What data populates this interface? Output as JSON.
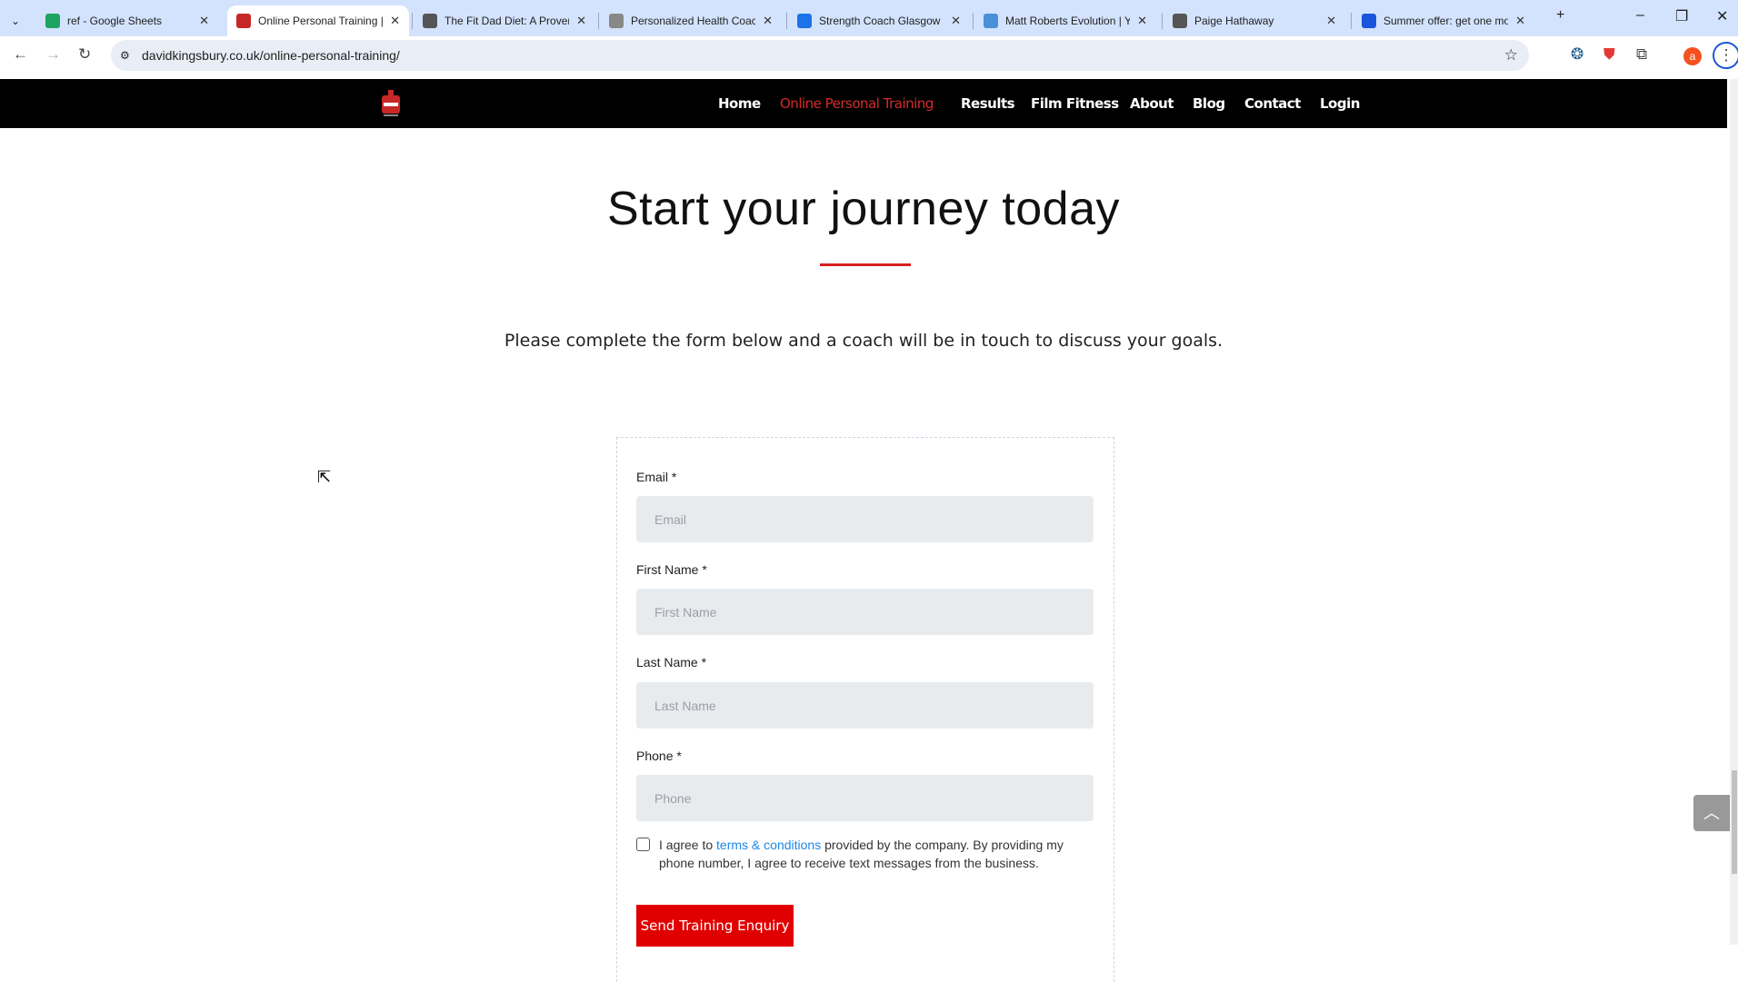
{
  "browser": {
    "tabs": [
      {
        "title": "ref - Google Sheets",
        "icon": "sheets-icon",
        "color": "#1ea362"
      },
      {
        "title": "Online Personal Training |",
        "icon": "kingsbury-icon",
        "color": "#c62828",
        "active": true
      },
      {
        "title": "The Fit Dad Diet: A Proven",
        "icon": "globe-icon",
        "color": "#555555"
      },
      {
        "title": "Personalized Health Coach",
        "icon": "health-icon",
        "color": "#888888"
      },
      {
        "title": "Strength Coach Glasgow -",
        "icon": "s-icon",
        "color": "#1a73e8"
      },
      {
        "title": "Matt Roberts Evolution | Y",
        "icon": "m-icon",
        "color": "#4a90d9"
      },
      {
        "title": "Paige Hathaway",
        "icon": "globe-icon",
        "color": "#555555"
      },
      {
        "title": "Summer offer: get one mo",
        "icon": "offer-icon",
        "color": "#1a56db"
      }
    ],
    "url": "davidkingsbury.co.uk/online-personal-training/"
  },
  "nav": {
    "items": [
      "Home",
      "Online Personal Training",
      "Results",
      "Film Fitness",
      "About",
      "Blog",
      "Contact",
      "Login"
    ],
    "active": "Online Personal Training",
    "active_color": "#d42b2b"
  },
  "hero": {
    "title": "Start your journey today",
    "subtitle": "Please complete the form below and a coach will be in touch to discuss your goals."
  },
  "form": {
    "fields": [
      {
        "label": "Email *",
        "placeholder": "Email"
      },
      {
        "label": "First Name *",
        "placeholder": "First Name"
      },
      {
        "label": "Last Name *",
        "placeholder": "Last Name"
      },
      {
        "label": "Phone *",
        "placeholder": "Phone"
      }
    ],
    "agree_pre": "I agree to ",
    "agree_link": "terms & conditions",
    "agree_post": " provided by the company. By providing my phone number, I agree to receive text messages from the business.",
    "submit": "Send Training Enquiry",
    "button_color": "#e00000"
  }
}
